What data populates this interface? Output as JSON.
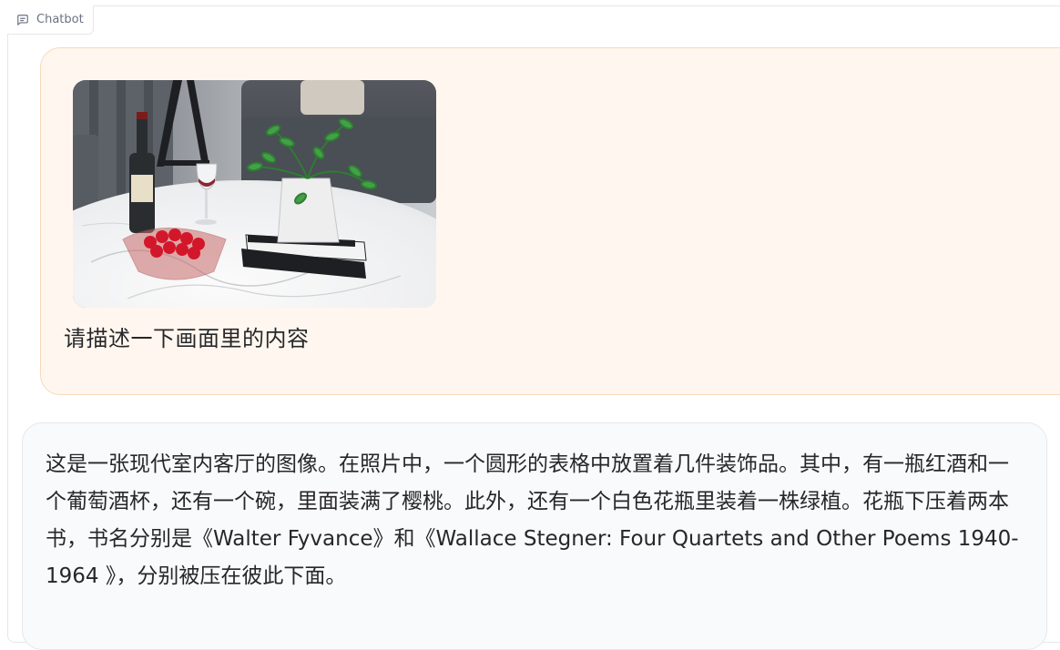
{
  "panel": {
    "label": "Chatbot",
    "label_icon": "chat-bubble-icon"
  },
  "messages": [
    {
      "role": "user",
      "image": {
        "kind": "photo",
        "subject": "living-room-coffee-table"
      },
      "text": "请描述一下画面里的内容"
    },
    {
      "role": "bot",
      "text": "这是一张现代室内客厅的图像。在照片中，一个圆形的表格中放置着几件装饰品。其中，有一瓶红酒和一个葡萄酒杯，还有一个碗，里面装满了樱桃。此外，还有一个白色花瓶里装着一株绿植。花瓶下压着两本书，书名分别是《Walter Fyvance》和《Wallace Stegner: Four Quartets and Other Poems 1940-1964 》，分别被压在彼此下面。"
    }
  ],
  "colors": {
    "user_bubble_bg": "#fff7ef",
    "user_bubble_border": "#f7d9b9",
    "bot_bubble_bg": "#f9fafb",
    "bot_bubble_border": "#e5e7eb"
  }
}
